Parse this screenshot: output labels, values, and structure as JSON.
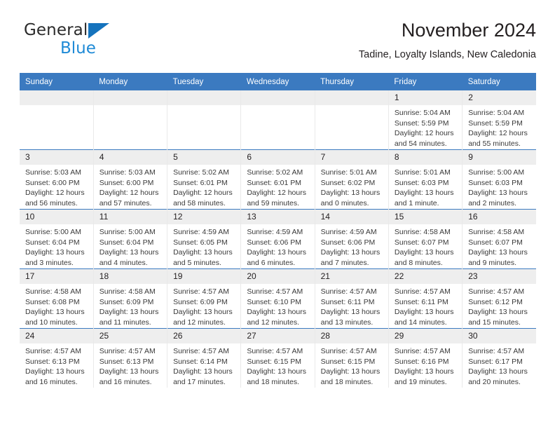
{
  "brand": {
    "name_dark": "General",
    "name_blue": "Blue",
    "triangle_icon": "blue-triangle-logo-mark",
    "accent_color": "#1f8ad6"
  },
  "header": {
    "title": "November 2024",
    "subtitle": "Tadine, Loyalty Islands, New Caledonia"
  },
  "theme": {
    "header_blue": "#3b7ac0",
    "daynum_gray": "#eeeeee",
    "text_dark": "#231f20"
  },
  "weekday_headers": [
    "Sunday",
    "Monday",
    "Tuesday",
    "Wednesday",
    "Thursday",
    "Friday",
    "Saturday"
  ],
  "weeks": [
    [
      {
        "day": "",
        "sunrise": "",
        "sunset": "",
        "daylight1": "",
        "daylight2": ""
      },
      {
        "day": "",
        "sunrise": "",
        "sunset": "",
        "daylight1": "",
        "daylight2": ""
      },
      {
        "day": "",
        "sunrise": "",
        "sunset": "",
        "daylight1": "",
        "daylight2": ""
      },
      {
        "day": "",
        "sunrise": "",
        "sunset": "",
        "daylight1": "",
        "daylight2": ""
      },
      {
        "day": "",
        "sunrise": "",
        "sunset": "",
        "daylight1": "",
        "daylight2": ""
      },
      {
        "day": "1",
        "sunrise": "Sunrise: 5:04 AM",
        "sunset": "Sunset: 5:59 PM",
        "daylight1": "Daylight: 12 hours",
        "daylight2": "and 54 minutes."
      },
      {
        "day": "2",
        "sunrise": "Sunrise: 5:04 AM",
        "sunset": "Sunset: 5:59 PM",
        "daylight1": "Daylight: 12 hours",
        "daylight2": "and 55 minutes."
      }
    ],
    [
      {
        "day": "3",
        "sunrise": "Sunrise: 5:03 AM",
        "sunset": "Sunset: 6:00 PM",
        "daylight1": "Daylight: 12 hours",
        "daylight2": "and 56 minutes."
      },
      {
        "day": "4",
        "sunrise": "Sunrise: 5:03 AM",
        "sunset": "Sunset: 6:00 PM",
        "daylight1": "Daylight: 12 hours",
        "daylight2": "and 57 minutes."
      },
      {
        "day": "5",
        "sunrise": "Sunrise: 5:02 AM",
        "sunset": "Sunset: 6:01 PM",
        "daylight1": "Daylight: 12 hours",
        "daylight2": "and 58 minutes."
      },
      {
        "day": "6",
        "sunrise": "Sunrise: 5:02 AM",
        "sunset": "Sunset: 6:01 PM",
        "daylight1": "Daylight: 12 hours",
        "daylight2": "and 59 minutes."
      },
      {
        "day": "7",
        "sunrise": "Sunrise: 5:01 AM",
        "sunset": "Sunset: 6:02 PM",
        "daylight1": "Daylight: 13 hours",
        "daylight2": "and 0 minutes."
      },
      {
        "day": "8",
        "sunrise": "Sunrise: 5:01 AM",
        "sunset": "Sunset: 6:03 PM",
        "daylight1": "Daylight: 13 hours",
        "daylight2": "and 1 minute."
      },
      {
        "day": "9",
        "sunrise": "Sunrise: 5:00 AM",
        "sunset": "Sunset: 6:03 PM",
        "daylight1": "Daylight: 13 hours",
        "daylight2": "and 2 minutes."
      }
    ],
    [
      {
        "day": "10",
        "sunrise": "Sunrise: 5:00 AM",
        "sunset": "Sunset: 6:04 PM",
        "daylight1": "Daylight: 13 hours",
        "daylight2": "and 3 minutes."
      },
      {
        "day": "11",
        "sunrise": "Sunrise: 5:00 AM",
        "sunset": "Sunset: 6:04 PM",
        "daylight1": "Daylight: 13 hours",
        "daylight2": "and 4 minutes."
      },
      {
        "day": "12",
        "sunrise": "Sunrise: 4:59 AM",
        "sunset": "Sunset: 6:05 PM",
        "daylight1": "Daylight: 13 hours",
        "daylight2": "and 5 minutes."
      },
      {
        "day": "13",
        "sunrise": "Sunrise: 4:59 AM",
        "sunset": "Sunset: 6:06 PM",
        "daylight1": "Daylight: 13 hours",
        "daylight2": "and 6 minutes."
      },
      {
        "day": "14",
        "sunrise": "Sunrise: 4:59 AM",
        "sunset": "Sunset: 6:06 PM",
        "daylight1": "Daylight: 13 hours",
        "daylight2": "and 7 minutes."
      },
      {
        "day": "15",
        "sunrise": "Sunrise: 4:58 AM",
        "sunset": "Sunset: 6:07 PM",
        "daylight1": "Daylight: 13 hours",
        "daylight2": "and 8 minutes."
      },
      {
        "day": "16",
        "sunrise": "Sunrise: 4:58 AM",
        "sunset": "Sunset: 6:07 PM",
        "daylight1": "Daylight: 13 hours",
        "daylight2": "and 9 minutes."
      }
    ],
    [
      {
        "day": "17",
        "sunrise": "Sunrise: 4:58 AM",
        "sunset": "Sunset: 6:08 PM",
        "daylight1": "Daylight: 13 hours",
        "daylight2": "and 10 minutes."
      },
      {
        "day": "18",
        "sunrise": "Sunrise: 4:58 AM",
        "sunset": "Sunset: 6:09 PM",
        "daylight1": "Daylight: 13 hours",
        "daylight2": "and 11 minutes."
      },
      {
        "day": "19",
        "sunrise": "Sunrise: 4:57 AM",
        "sunset": "Sunset: 6:09 PM",
        "daylight1": "Daylight: 13 hours",
        "daylight2": "and 12 minutes."
      },
      {
        "day": "20",
        "sunrise": "Sunrise: 4:57 AM",
        "sunset": "Sunset: 6:10 PM",
        "daylight1": "Daylight: 13 hours",
        "daylight2": "and 12 minutes."
      },
      {
        "day": "21",
        "sunrise": "Sunrise: 4:57 AM",
        "sunset": "Sunset: 6:11 PM",
        "daylight1": "Daylight: 13 hours",
        "daylight2": "and 13 minutes."
      },
      {
        "day": "22",
        "sunrise": "Sunrise: 4:57 AM",
        "sunset": "Sunset: 6:11 PM",
        "daylight1": "Daylight: 13 hours",
        "daylight2": "and 14 minutes."
      },
      {
        "day": "23",
        "sunrise": "Sunrise: 4:57 AM",
        "sunset": "Sunset: 6:12 PM",
        "daylight1": "Daylight: 13 hours",
        "daylight2": "and 15 minutes."
      }
    ],
    [
      {
        "day": "24",
        "sunrise": "Sunrise: 4:57 AM",
        "sunset": "Sunset: 6:13 PM",
        "daylight1": "Daylight: 13 hours",
        "daylight2": "and 16 minutes."
      },
      {
        "day": "25",
        "sunrise": "Sunrise: 4:57 AM",
        "sunset": "Sunset: 6:13 PM",
        "daylight1": "Daylight: 13 hours",
        "daylight2": "and 16 minutes."
      },
      {
        "day": "26",
        "sunrise": "Sunrise: 4:57 AM",
        "sunset": "Sunset: 6:14 PM",
        "daylight1": "Daylight: 13 hours",
        "daylight2": "and 17 minutes."
      },
      {
        "day": "27",
        "sunrise": "Sunrise: 4:57 AM",
        "sunset": "Sunset: 6:15 PM",
        "daylight1": "Daylight: 13 hours",
        "daylight2": "and 18 minutes."
      },
      {
        "day": "28",
        "sunrise": "Sunrise: 4:57 AM",
        "sunset": "Sunset: 6:15 PM",
        "daylight1": "Daylight: 13 hours",
        "daylight2": "and 18 minutes."
      },
      {
        "day": "29",
        "sunrise": "Sunrise: 4:57 AM",
        "sunset": "Sunset: 6:16 PM",
        "daylight1": "Daylight: 13 hours",
        "daylight2": "and 19 minutes."
      },
      {
        "day": "30",
        "sunrise": "Sunrise: 4:57 AM",
        "sunset": "Sunset: 6:17 PM",
        "daylight1": "Daylight: 13 hours",
        "daylight2": "and 20 minutes."
      }
    ]
  ]
}
